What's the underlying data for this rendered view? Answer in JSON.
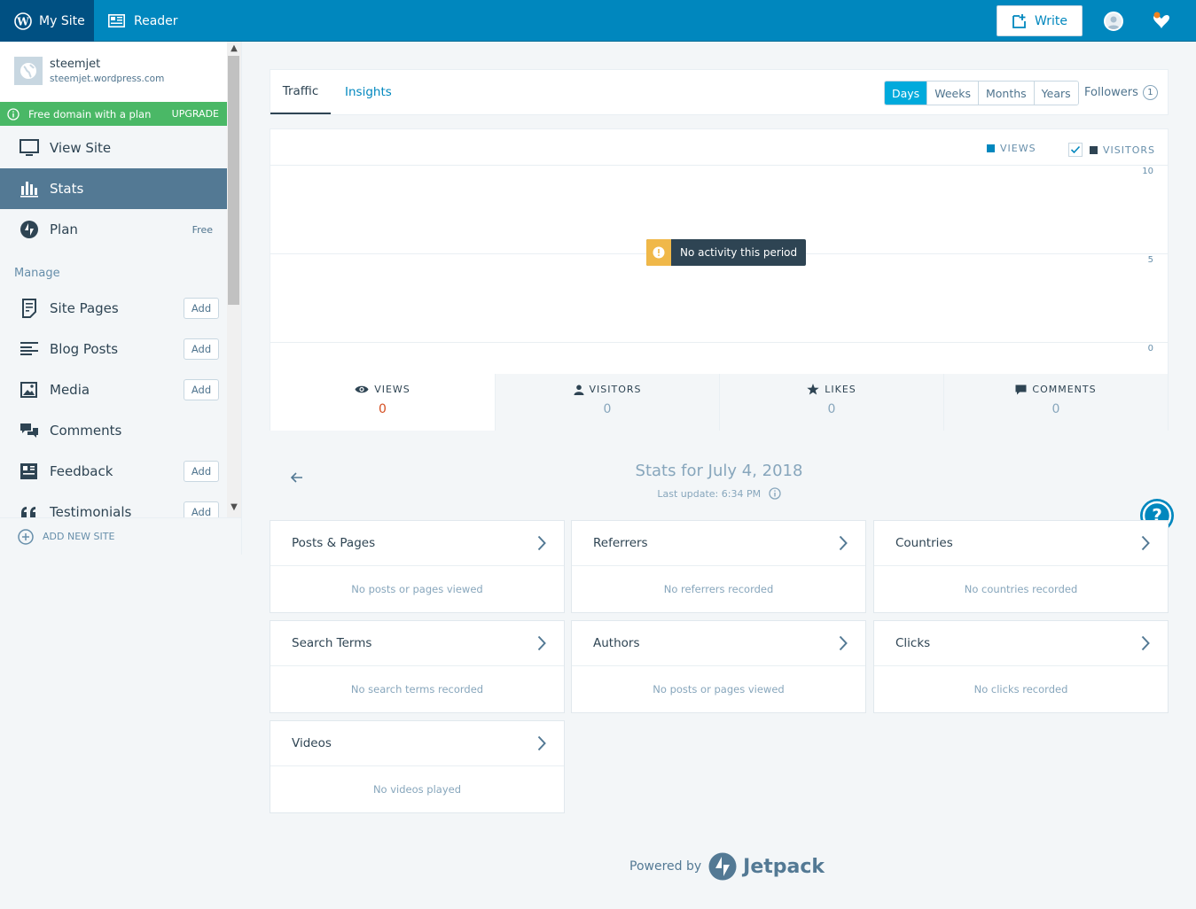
{
  "topbar": {
    "my_site": "My Site",
    "reader": "Reader",
    "write": "Write"
  },
  "site": {
    "name": "steemjet",
    "url": "steemjet.wordpress.com"
  },
  "upgrade": {
    "text": "Free domain with a plan",
    "action": "UPGRADE"
  },
  "nav": {
    "view_site": "View Site",
    "stats": "Stats",
    "plan": "Plan",
    "plan_badge": "Free",
    "manage_heading": "Manage",
    "site_pages": "Site Pages",
    "blog_posts": "Blog Posts",
    "media": "Media",
    "comments": "Comments",
    "feedback": "Feedback",
    "testimonials": "Testimonials",
    "add_label": "Add",
    "add_new_site": "ADD NEW SITE"
  },
  "tabs": {
    "traffic": "Traffic",
    "insights": "Insights"
  },
  "periods": [
    "Days",
    "Weeks",
    "Months",
    "Years"
  ],
  "selected_period": "Days",
  "followers": {
    "label": "Followers",
    "count": "1"
  },
  "chart": {
    "legend_views": "VIEWS",
    "legend_visitors": "VISITORS",
    "visitors_checked": true,
    "ticks": [
      "10",
      "5",
      "0"
    ],
    "notice": "No activity this period",
    "colors": {
      "views": "#0087be",
      "visitors": "#2e4453"
    }
  },
  "summary": [
    {
      "label": "VIEWS",
      "value": "0"
    },
    {
      "label": "VISITORS",
      "value": "0"
    },
    {
      "label": "LIKES",
      "value": "0"
    },
    {
      "label": "COMMENTS",
      "value": "0"
    }
  ],
  "stats_for": "Stats for July 4, 2018",
  "last_update": "Last update: 6:34 PM",
  "modules": [
    {
      "title": "Posts & Pages",
      "empty": "No posts or pages viewed"
    },
    {
      "title": "Referrers",
      "empty": "No referrers recorded"
    },
    {
      "title": "Countries",
      "empty": "No countries recorded"
    },
    {
      "title": "Search Terms",
      "empty": "No search terms recorded"
    },
    {
      "title": "Authors",
      "empty": "No posts or pages viewed"
    },
    {
      "title": "Clicks",
      "empty": "No clicks recorded"
    },
    {
      "title": "Videos",
      "empty": "No videos played"
    }
  ],
  "footer": {
    "powered_by": "Powered by",
    "brand": "Jetpack"
  },
  "colors": {
    "brand_blue": "#0087be",
    "upgrade_green": "#4ab866",
    "active_nav": "#537994",
    "views_value": "#d54e21"
  }
}
